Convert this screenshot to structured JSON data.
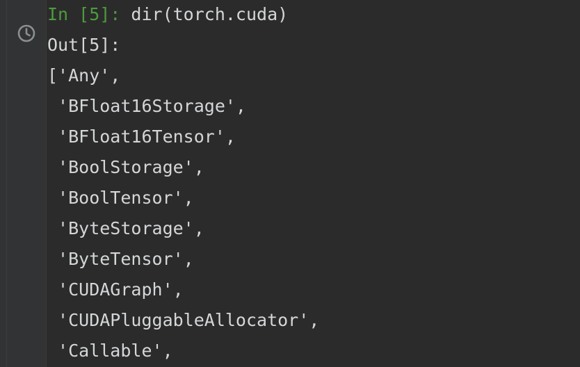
{
  "console": {
    "input": {
      "prompt": "In [5]:",
      "command": " dir(torch.cuda)"
    },
    "output_prompt": "Out[5]:",
    "output_lines": [
      "['Any',",
      " 'BFloat16Storage',",
      " 'BFloat16Tensor',",
      " 'BoolStorage',",
      " 'BoolTensor',",
      " 'ByteStorage',",
      " 'ByteTensor',",
      " 'CUDAGraph',",
      " 'CUDAPluggableAllocator',",
      " 'Callable',"
    ]
  },
  "colors": {
    "background": "#2b2b2b",
    "gutter": "#313335",
    "prompt_green": "#4e9a3e",
    "text": "#d4d6d8",
    "icon_gray": "#8c8f91"
  },
  "icons": {
    "history": "clock-icon"
  }
}
